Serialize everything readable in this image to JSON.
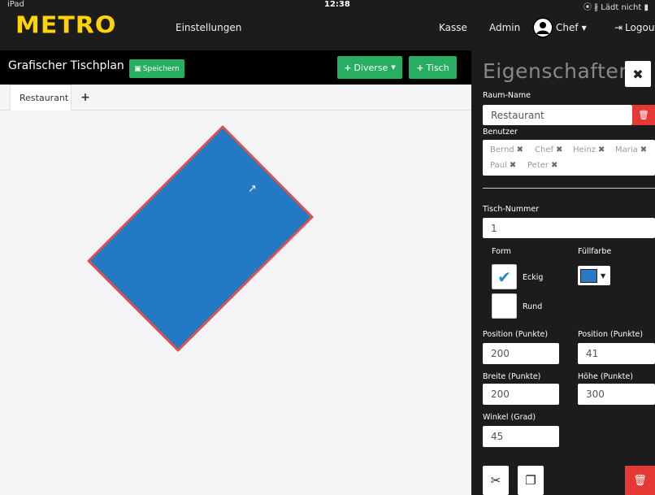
{
  "status": {
    "carrier": "iPad",
    "time": "12:38",
    "battery": "⦿ ∦ Lädt nicht ▮"
  },
  "nav": {
    "logo": "METRO",
    "einstellungen": "Einstellungen",
    "kasse": "Kasse",
    "admin": "Admin",
    "user": "Chef",
    "logout": "Logout"
  },
  "plan": {
    "title": "Grafischer Tischplan",
    "save": "Speichern",
    "diverse": "Diverse",
    "tisch": "Tisch"
  },
  "tabs": {
    "restaurant": "Restaurant",
    "add": "+"
  },
  "table": {
    "rotate_handle": "↗",
    "fill_color": "#2379c3",
    "border_color": "#d9534f"
  },
  "props": {
    "title": "Eigenschaften",
    "raum_label": "Raum-Name",
    "raum_value": "Restaurant",
    "benutzer_label": "Benutzer",
    "users": [
      "Bernd",
      "Chef",
      "Heinz",
      "Maria",
      "Paul",
      "Peter"
    ],
    "tisch_label": "Tisch-Nummer",
    "tisch_value": "1",
    "form_label": "Form",
    "fuellfarbe_label": "Füllfarbe",
    "eckig": "Eckig",
    "rund": "Rund",
    "pos_x_label": "Position (Punkte)",
    "pos_x_value": "200",
    "pos_y_label": "Position (Punkte)",
    "pos_y_value": "41",
    "breite_label": "Breite (Punkte)",
    "breite_value": "200",
    "hoehe_label": "Höhe (Punkte)",
    "hoehe_value": "300",
    "winkel_label": "Winkel (Grad)",
    "winkel_value": "45",
    "fill_swatch": "#2979c4"
  }
}
